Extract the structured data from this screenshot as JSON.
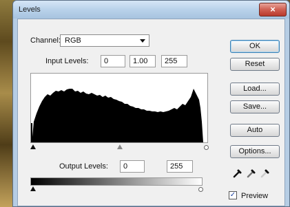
{
  "window": {
    "title": "Levels",
    "close_glyph": "×"
  },
  "channel": {
    "label": "Channel:",
    "value": "RGB"
  },
  "input_levels": {
    "label": "Input Levels:",
    "black": "0",
    "gamma": "1.00",
    "white": "255"
  },
  "output_levels": {
    "label": "Output Levels:",
    "black": "0",
    "white": "255"
  },
  "buttons": {
    "ok": "OK",
    "reset": "Reset",
    "load": "Load...",
    "save": "Save...",
    "auto": "Auto",
    "options": "Options..."
  },
  "preview": {
    "label": "Preview",
    "checked": true
  },
  "icons": [
    "black-point-eyedropper-icon",
    "gray-point-eyedropper-icon",
    "white-point-eyedropper-icon"
  ]
}
